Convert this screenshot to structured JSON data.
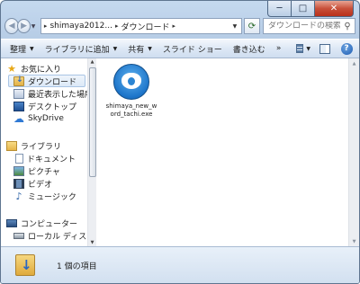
{
  "window": {
    "caption_buttons": {
      "minimize": "─",
      "maximize": "□",
      "close": "✕"
    }
  },
  "address": {
    "segments": [
      "shimaya2012...",
      "ダウンロード"
    ],
    "separator": "▸",
    "back_glyph": "◀",
    "forward_glyph": "▶",
    "refresh_glyph": "⟳"
  },
  "search": {
    "placeholder": "ダウンロードの検索",
    "icon": "search-icon"
  },
  "commandbar": {
    "items": [
      "整理",
      "ライブラリに追加",
      "共有",
      "スライド ショー",
      "書き込む"
    ],
    "more": "»"
  },
  "nav": {
    "favorites": {
      "label": "お気に入り",
      "icon": "star-icon"
    },
    "downloads": {
      "label": "ダウンロード",
      "icon": "downloads-folder-icon"
    },
    "recent": {
      "label": "最近表示した場所",
      "icon": "recent-places-icon"
    },
    "desktop": {
      "label": "デスクトップ",
      "icon": "desktop-icon"
    },
    "skydrive": {
      "label": "SkyDrive",
      "icon": "skydrive-icon"
    },
    "libraries": {
      "label": "ライブラリ",
      "icon": "library-icon"
    },
    "documents": {
      "label": "ドキュメント",
      "icon": "documents-icon"
    },
    "pictures": {
      "label": "ピクチャ",
      "icon": "pictures-icon"
    },
    "videos": {
      "label": "ビデオ",
      "icon": "videos-icon"
    },
    "music": {
      "label": "ミュージック",
      "icon": "music-icon"
    },
    "computer": {
      "label": "コンピューター",
      "icon": "computer-icon"
    },
    "localdisk": {
      "label": "ローカル ディスク",
      "icon": "local-disk-icon"
    }
  },
  "files": [
    {
      "name": "shimaya_new_word_tachi.exe",
      "icon": "installer-app-icon"
    }
  ],
  "status": {
    "text": "1 個の項目"
  },
  "colors": {
    "frame": "#c5d9ef",
    "selection": "#dce9f7",
    "close_button": "#c8503a"
  }
}
